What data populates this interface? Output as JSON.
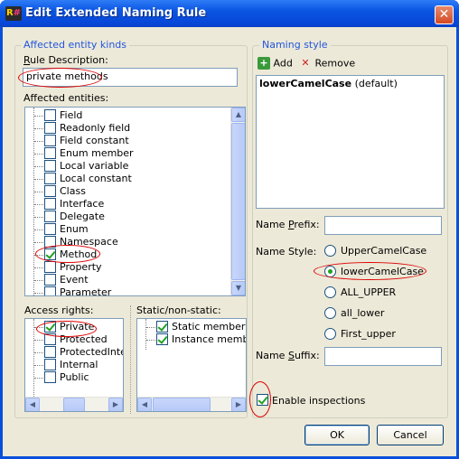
{
  "window": {
    "title": "Edit Extended Naming Rule",
    "close_glyph": "✕",
    "icon": "resharper-icon"
  },
  "affected_kinds": {
    "group_label": "Affected entity kinds",
    "rule_description_label": "Rule Description:",
    "rule_description_value": "private methods",
    "affected_entities_label": "Affected entities:",
    "entities": [
      {
        "label": "Field",
        "checked": false
      },
      {
        "label": "Readonly field",
        "checked": false
      },
      {
        "label": "Field constant",
        "checked": false
      },
      {
        "label": "Enum member",
        "checked": false
      },
      {
        "label": "Local variable",
        "checked": false
      },
      {
        "label": "Local constant",
        "checked": false
      },
      {
        "label": "Class",
        "checked": false
      },
      {
        "label": "Interface",
        "checked": false
      },
      {
        "label": "Delegate",
        "checked": false
      },
      {
        "label": "Enum",
        "checked": false
      },
      {
        "label": "Namespace",
        "checked": false
      },
      {
        "label": "Method",
        "checked": true
      },
      {
        "label": "Property",
        "checked": false
      },
      {
        "label": "Event",
        "checked": false
      },
      {
        "label": "Parameter",
        "checked": false
      }
    ],
    "access_rights_label": "Access rights:",
    "access_rights": [
      {
        "label": "Private",
        "checked": true
      },
      {
        "label": "Protected",
        "checked": false
      },
      {
        "label": "ProtectedInter",
        "checked": false
      },
      {
        "label": "Internal",
        "checked": false
      },
      {
        "label": "Public",
        "checked": false
      }
    ],
    "static_label": "Static/non-static:",
    "static_options": [
      {
        "label": "Static members, t",
        "checked": true
      },
      {
        "label": "Instance member",
        "checked": true
      }
    ]
  },
  "naming_style": {
    "group_label": "Naming style",
    "add_label": "Add",
    "remove_label": "Remove",
    "styles": [
      {
        "name": "lowerCamelCase",
        "suffix": " (default)"
      }
    ],
    "prefix_label": "Name Prefix:",
    "prefix_value": "",
    "style_label": "Name Style:",
    "style_options": [
      {
        "label": "UpperCamelCase",
        "selected": false
      },
      {
        "label": "lowerCamelCase",
        "selected": true
      },
      {
        "label": "ALL_UPPER",
        "selected": false
      },
      {
        "label": "all_lower",
        "selected": false
      },
      {
        "label": "First_upper",
        "selected": false
      }
    ],
    "suffix_label": "Name Suffix:",
    "suffix_value": "",
    "enable_inspections_label": "Enable inspections",
    "enable_inspections_checked": true
  },
  "footer": {
    "ok_label": "OK",
    "cancel_label": "Cancel"
  },
  "colors": {
    "title_bar": "#0a55e2",
    "group_label": "#2255dd",
    "annotation": "#dd0000",
    "check": "#21a121"
  }
}
